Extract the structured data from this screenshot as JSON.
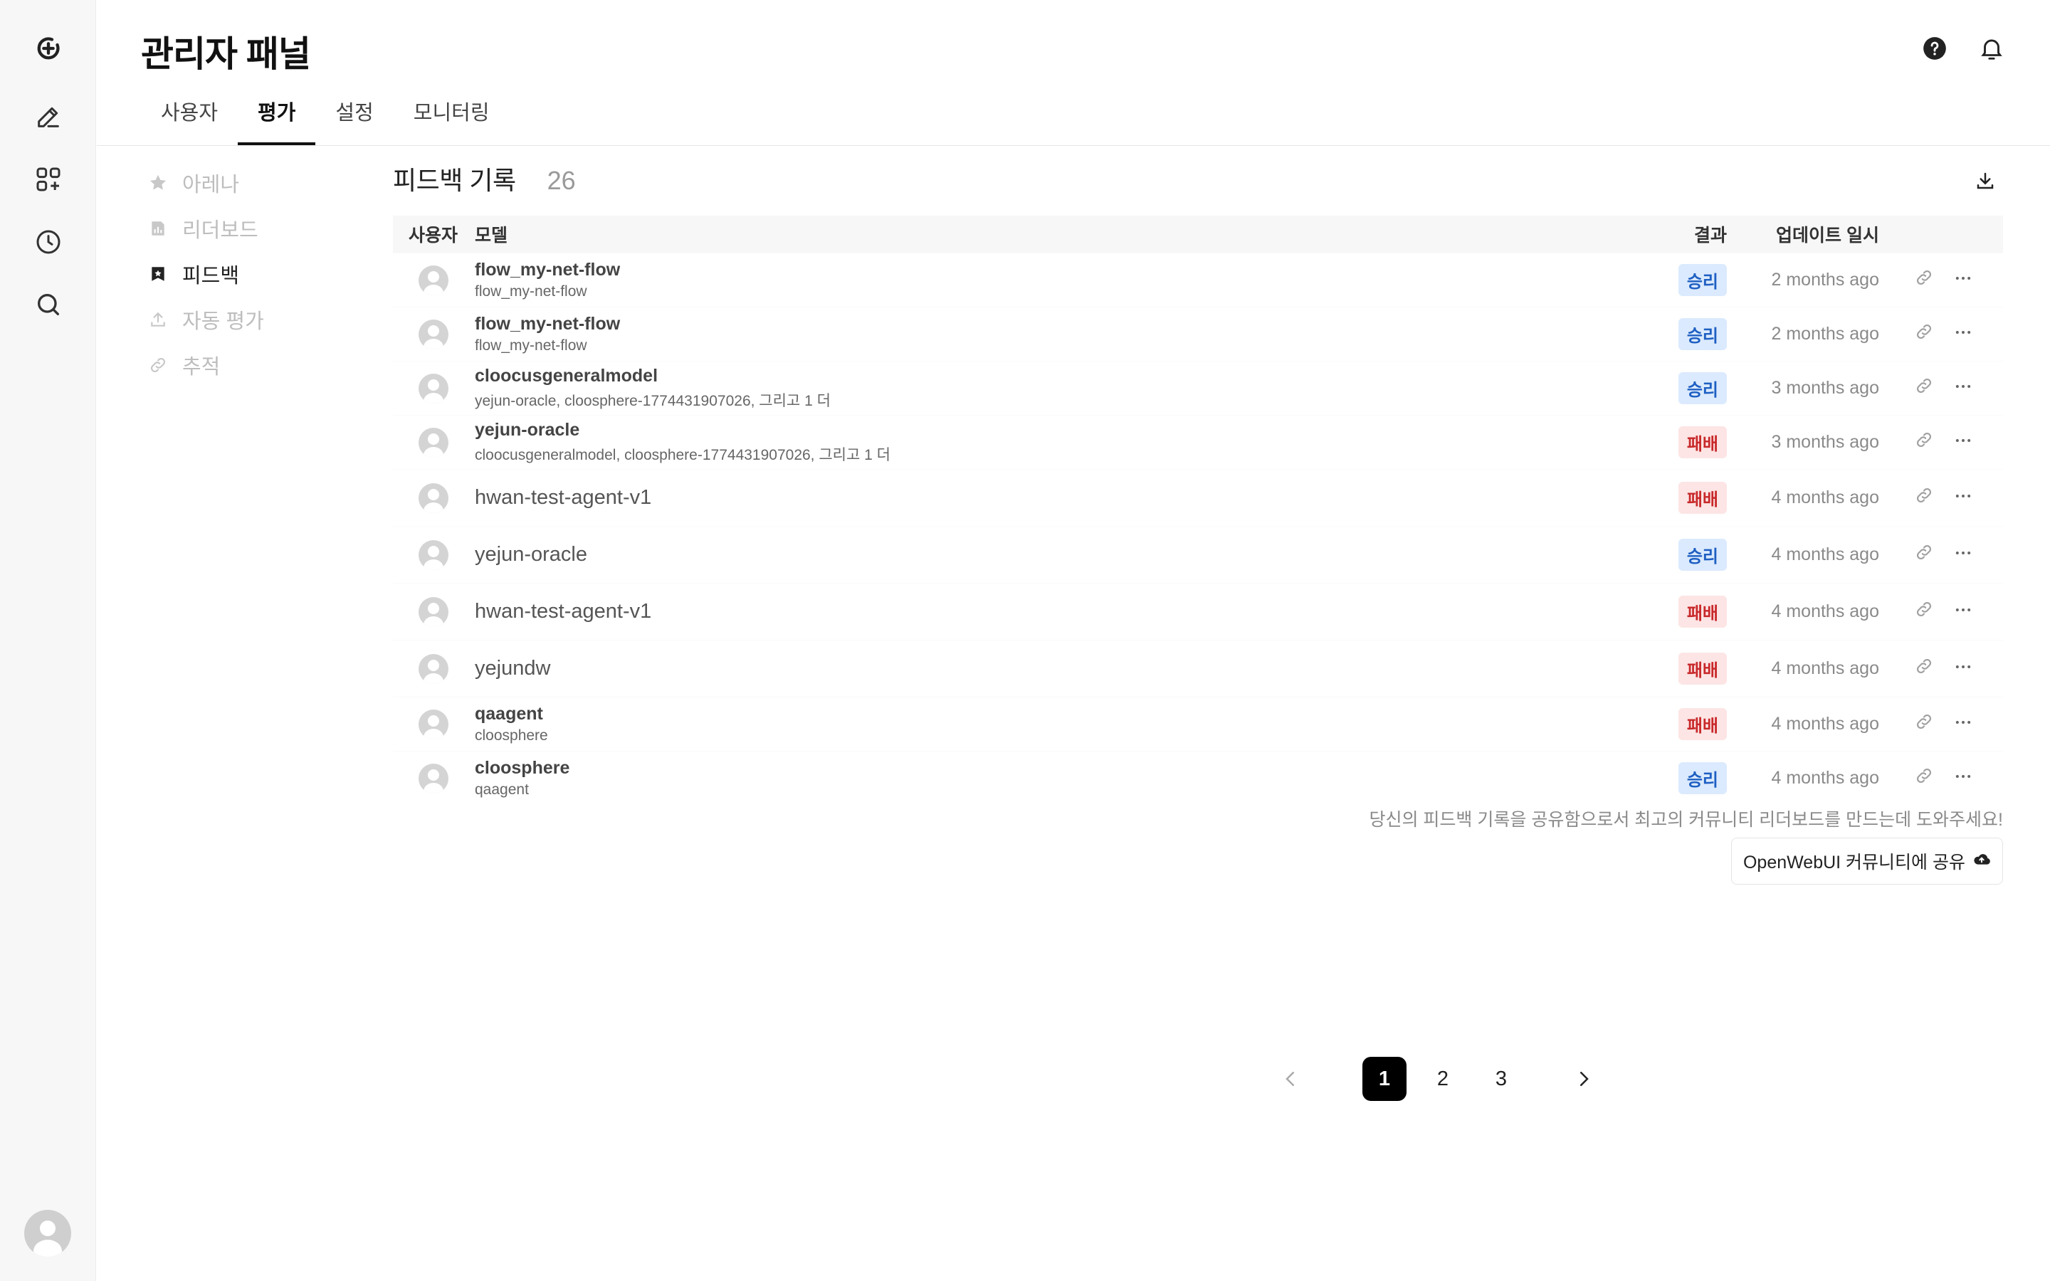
{
  "page": {
    "title": "관리자 패널"
  },
  "tabs": [
    {
      "label": "사용자",
      "active": false
    },
    {
      "label": "평가",
      "active": true
    },
    {
      "label": "설정",
      "active": false
    },
    {
      "label": "모니터링",
      "active": false
    }
  ],
  "subnav": [
    {
      "label": "아레나",
      "icon": "star-icon",
      "active": false
    },
    {
      "label": "리더보드",
      "icon": "chart-icon",
      "active": false
    },
    {
      "label": "피드백",
      "icon": "feedback-icon",
      "active": true
    },
    {
      "label": "자동 평가",
      "icon": "upload-icon",
      "active": false
    },
    {
      "label": "추적",
      "icon": "link-icon",
      "active": false
    }
  ],
  "feedback": {
    "title": "피드백 기록",
    "count": "26",
    "columns": {
      "user": "사용자",
      "model": "모델",
      "result": "결과",
      "updated": "업데이트 일시"
    },
    "rows": [
      {
        "model": "flow_my-net-flow",
        "sub": "flow_my-net-flow",
        "result": "승리",
        "type": "win",
        "date": "2 months ago"
      },
      {
        "model": "flow_my-net-flow",
        "sub": "flow_my-net-flow",
        "result": "승리",
        "type": "win",
        "date": "2 months ago"
      },
      {
        "model": "cloocusgeneralmodel",
        "sub": "yejun-oracle, cloosphere-1774431907026, 그리고 1 더",
        "result": "승리",
        "type": "win",
        "date": "3 months ago"
      },
      {
        "model": "yejun-oracle",
        "sub": "cloocusgeneralmodel, cloosphere-1774431907026, 그리고 1 더",
        "result": "패배",
        "type": "lose",
        "date": "3 months ago"
      },
      {
        "model": "hwan-test-agent-v1",
        "sub": "",
        "result": "패배",
        "type": "lose",
        "date": "4 months ago"
      },
      {
        "model": "yejun-oracle",
        "sub": "",
        "result": "승리",
        "type": "win",
        "date": "4 months ago"
      },
      {
        "model": "hwan-test-agent-v1",
        "sub": "",
        "result": "패배",
        "type": "lose",
        "date": "4 months ago"
      },
      {
        "model": "yejundw",
        "sub": "",
        "result": "패배",
        "type": "lose",
        "date": "4 months ago"
      },
      {
        "model": "qaagent",
        "sub": "cloosphere",
        "result": "패배",
        "type": "lose",
        "date": "4 months ago"
      },
      {
        "model": "cloosphere",
        "sub": "qaagent",
        "result": "승리",
        "type": "win",
        "date": "4 months ago"
      }
    ],
    "share_text": "당신의 피드백 기록을 공유함으로서 최고의 커뮤니티 리더보드를 만드는데 도와주세요!",
    "share_button": "OpenWebUI 커뮤니티에 공유"
  },
  "pagination": {
    "pages": [
      "1",
      "2",
      "3"
    ],
    "current": "1"
  },
  "colors": {
    "win_bg": "#dbeafe",
    "win_fg": "#1e5fc2",
    "lose_bg": "#fde5e5",
    "lose_fg": "#c8282a"
  }
}
